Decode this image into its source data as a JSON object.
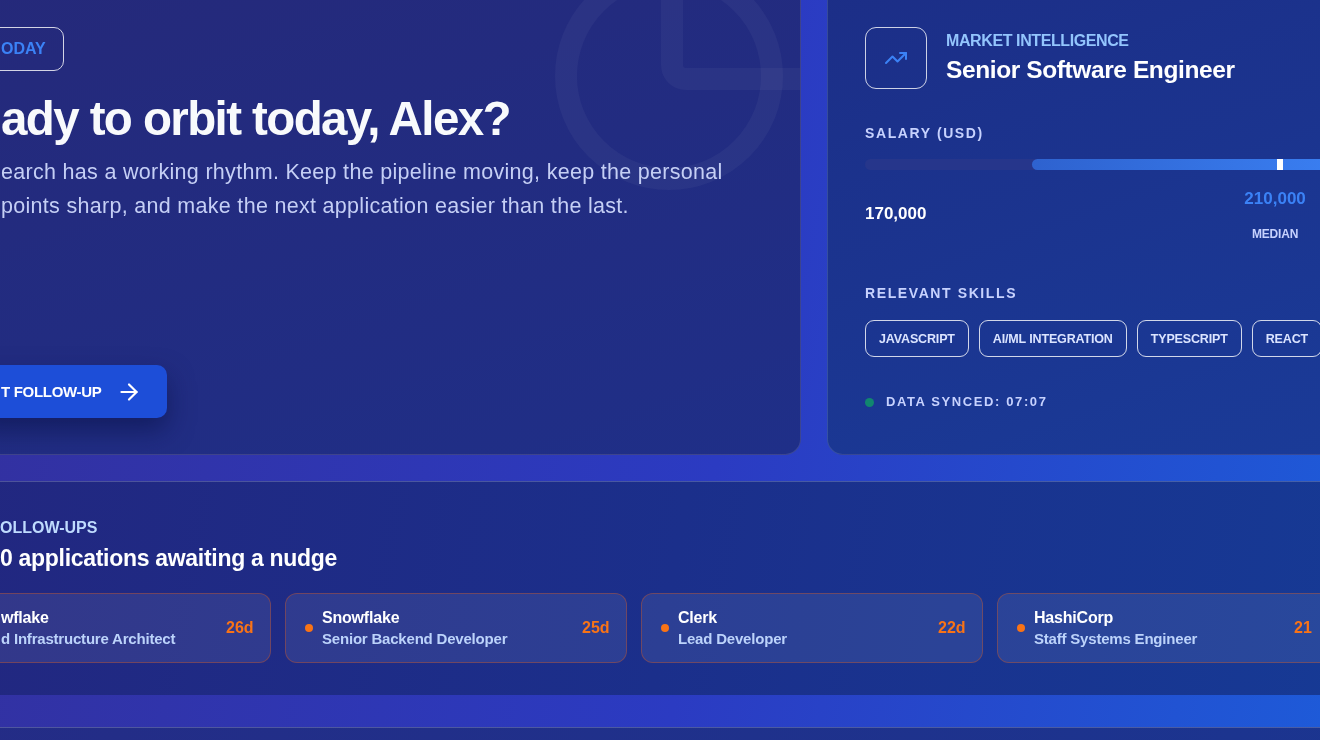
{
  "hero": {
    "badge": "ODAY",
    "title": "ady to orbit today, Alex?",
    "description": "earch has a working rhythm. Keep the pipeline moving, keep the personal points sharp, and make the next application easier than the last.",
    "button": "T FOLLOW-UP"
  },
  "market_intelligence": {
    "label": "MARKET INTELLIGENCE",
    "role": "Senior Software Engineer",
    "salary": {
      "label": "SALARY (USD)",
      "range": {
        "level": 0.65
      },
      "median_marker": {
        "level": 0.87
      },
      "low": "170,000",
      "median": "210,000",
      "median_label": "MEDIAN"
    },
    "skills_label": "RELEVANT SKILLS",
    "skills": [
      "JAVASCRIPT",
      "AI/ML INTEGRATION",
      "TYPESCRIPT",
      "REACT"
    ],
    "sync_status": "DATA SYNCED: 07:07"
  },
  "follow_ups": {
    "label": "OLLOW-UPS",
    "title": "0 applications awaiting a nudge",
    "items": [
      {
        "company": "wflake",
        "role": "d Infrastructure Architect",
        "days": "26d"
      },
      {
        "company": "Snowflake",
        "role": "Senior Backend Developer",
        "days": "25d",
        "color": "#f97316"
      },
      {
        "company": "Clerk",
        "role": "Lead Developer",
        "days": "22d",
        "color": "#f97316"
      },
      {
        "company": "HashiCorp",
        "role": "Staff Systems Engineer",
        "days": "21",
        "color": "#f97316"
      }
    ]
  }
}
